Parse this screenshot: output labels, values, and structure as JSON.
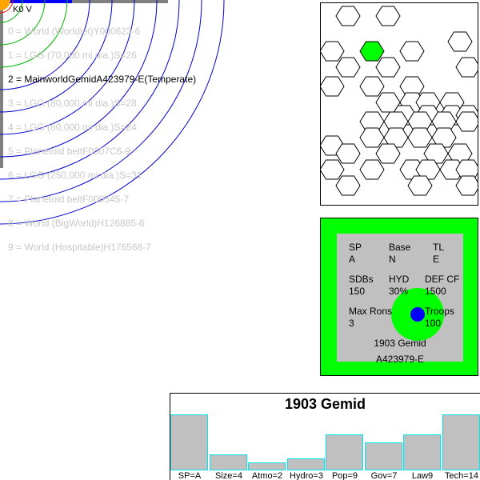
{
  "system": {
    "star_label": "K0 V",
    "orbits": [
      {
        "label": "0 = World  (Worldlet)Y000623-6",
        "active": false
      },
      {
        "label": "1 = LGG (70,000 mi dia.)S=26",
        "active": false
      },
      {
        "label": "2 = MainworldGemidA423979-E(Temperate)",
        "active": true
      },
      {
        "label": "3 = LGG (80,000 mi dia.)S=28",
        "active": false
      },
      {
        "label": "4 = LGG (60,000 mi dia.)S=24",
        "active": false
      },
      {
        "label": "5 = Planetoid beltF0007C6-9",
        "active": false
      },
      {
        "label": "6 = LGG (250,000 mi dia.)S=31",
        "active": false
      },
      {
        "label": "7 = Planetoid beltF000545-7",
        "active": false
      },
      {
        "label": "8 = World  (BigWorld)H126885-6",
        "active": false
      },
      {
        "label": "9 = World  (Hospitable)H176568-7",
        "active": false
      }
    ],
    "colors": {
      "star": "#ffa500",
      "habitable_orbit": "#00b400",
      "outer_orbit": "#0000cd",
      "inner_orbit": "#ff0000"
    }
  },
  "world": {
    "sp_label": "SP",
    "sp_value": "A",
    "base_label": "Base",
    "base_value": "N",
    "tl_label": "TL",
    "tl_value": "E",
    "sdbs_label": "SDBs",
    "sdbs_value": "150",
    "hyd_label": "HYD",
    "hyd_value": "30%",
    "def_label": "DEF CF",
    "def_value": "1500",
    "maxrons_label": "Max Rons",
    "maxrons_value": "3",
    "troops_label": "Troops",
    "troops_value": "100",
    "name": "1903 Gemid",
    "uwp": "A423979-E"
  },
  "stats": {
    "title": "1903 Gemid",
    "chart_data": {
      "type": "bar",
      "categories": [
        "SP=A",
        "Size=4",
        "Atmo=2",
        "Hydro=3",
        "Pop=9",
        "Gov=7",
        "Law9",
        "Tech=14"
      ],
      "values": [
        14,
        4,
        2,
        3,
        9,
        7,
        9,
        14
      ],
      "ylim": [
        0,
        14
      ]
    }
  }
}
